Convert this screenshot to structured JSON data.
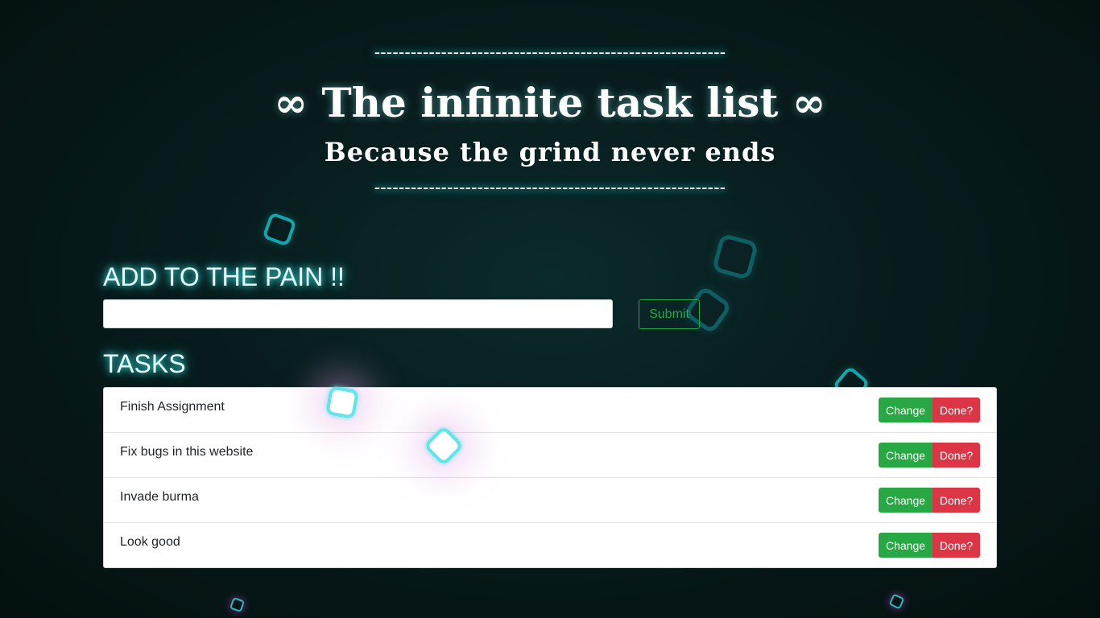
{
  "header": {
    "dash_line": "----------------------------------------------------------",
    "title": "∞ The infinite task list ∞",
    "subtitle": "Because the grind never ends"
  },
  "add_section": {
    "heading": "ADD TO THE PAIN !!",
    "input_value": "",
    "input_placeholder": "",
    "submit_label": "Submit"
  },
  "tasks_section": {
    "heading": "TASKS",
    "change_label": "Change",
    "done_label": "Done?",
    "items": [
      {
        "text": "Finish Assignment"
      },
      {
        "text": "Fix bugs in this website"
      },
      {
        "text": "Invade burma"
      },
      {
        "text": "Look good"
      }
    ]
  },
  "colors": {
    "background": "#081b1c",
    "neon_accent": "#3fdede",
    "change_button": "#28a745",
    "done_button": "#dc3545",
    "submit_outline": "#28a745"
  },
  "decorations": {
    "icon": "rounded-square-outline"
  }
}
